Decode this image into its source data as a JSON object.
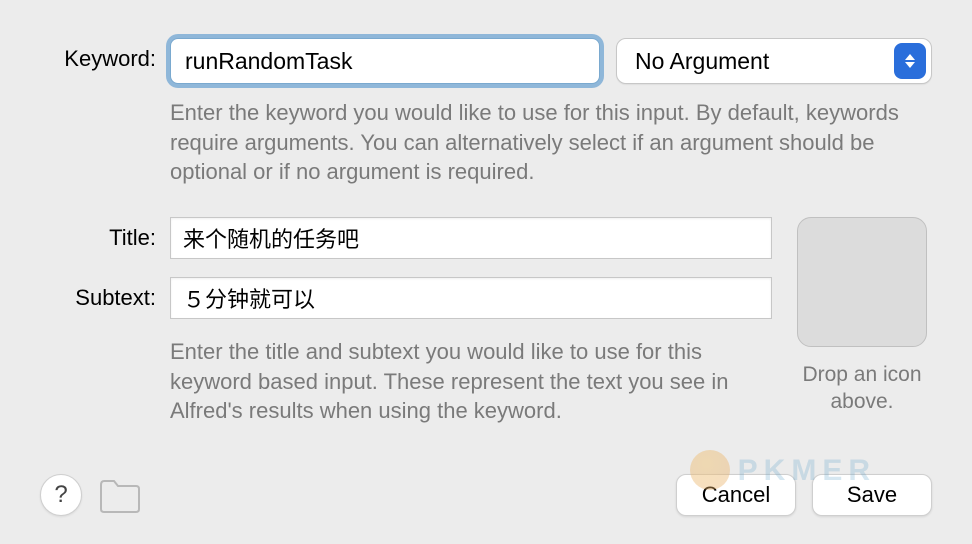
{
  "keyword": {
    "label": "Keyword:",
    "value": "runRandomTask",
    "argument_selected": "No Argument",
    "help": "Enter the keyword you would like to use for this input. By default, keywords require arguments. You can alternatively select if an argument should be optional or if no argument is required."
  },
  "title": {
    "label": "Title:",
    "value": "来个随机的任务吧"
  },
  "subtext": {
    "label": "Subtext:",
    "value": "５分钟就可以"
  },
  "title_help": "Enter the title and subtext you would like to use for this keyword based input. These represent the text you see in Alfred's results when using the keyword.",
  "icon_drop": "Drop an icon above.",
  "footer": {
    "help": "?",
    "cancel": "Cancel",
    "save": "Save"
  },
  "watermark": "PKMER"
}
